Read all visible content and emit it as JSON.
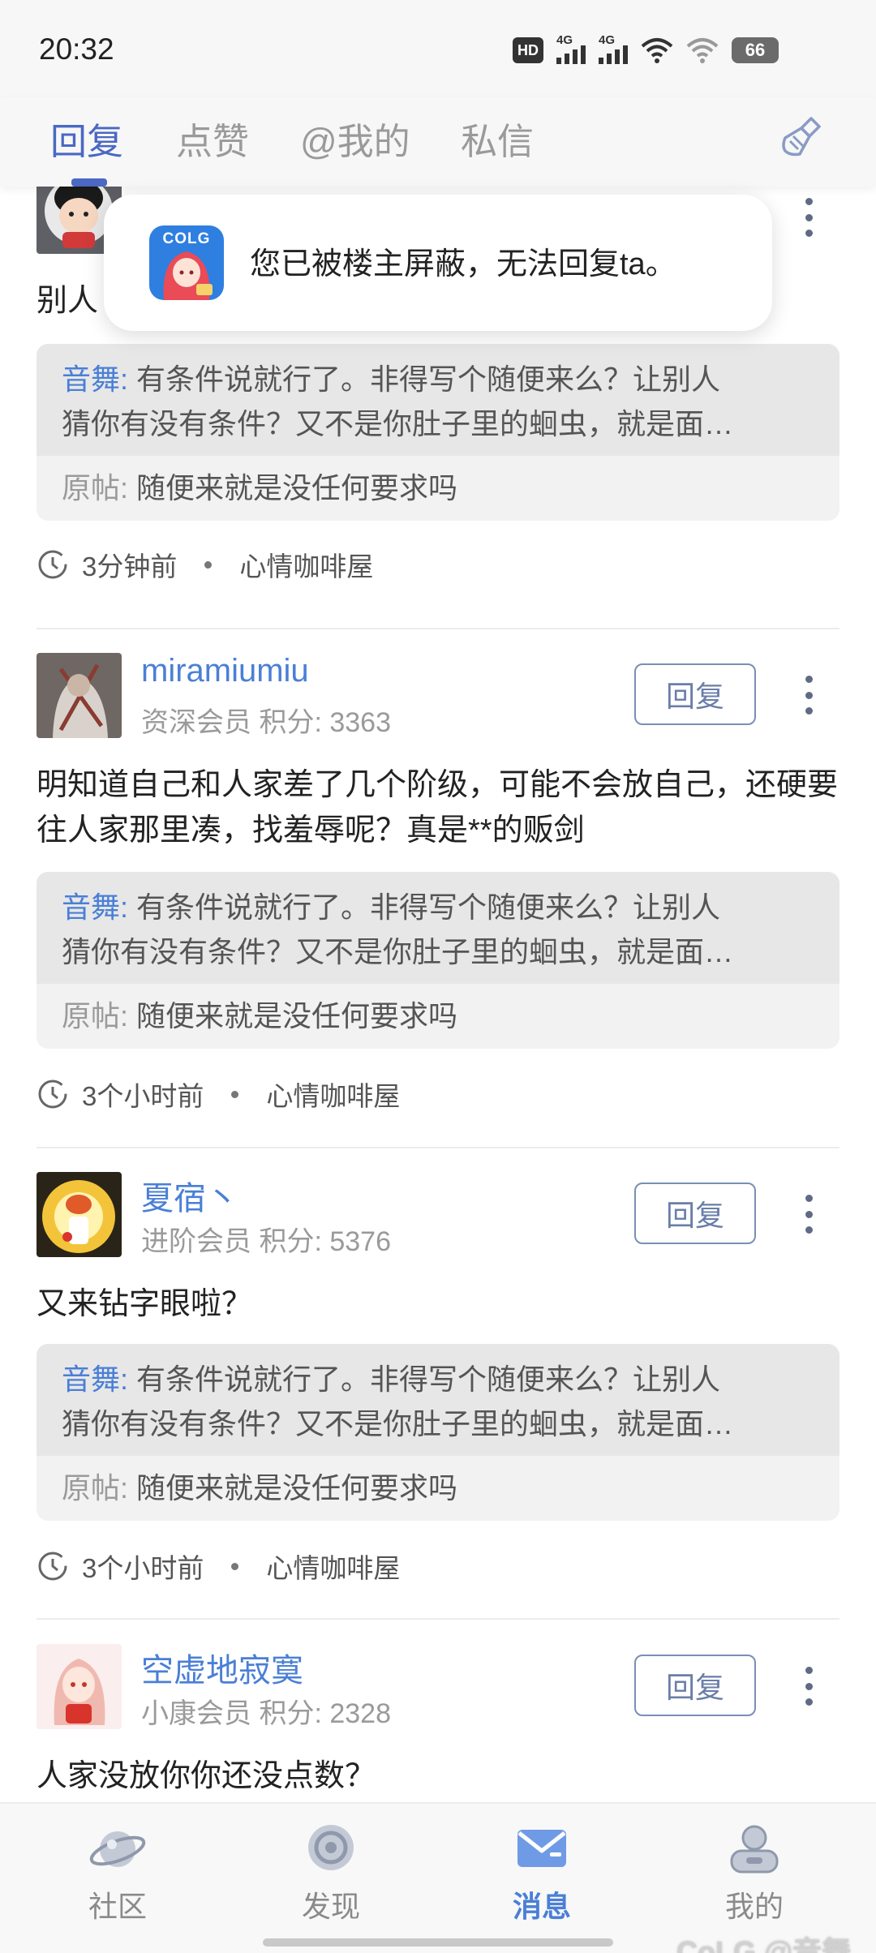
{
  "status_bar": {
    "time": "20:32",
    "hd_label": "HD",
    "net1": "4G",
    "net2": "4G",
    "battery": "66"
  },
  "tabs": [
    {
      "label": "回复",
      "active": true
    },
    {
      "label": "点赞",
      "active": false
    },
    {
      "label": "@我的",
      "active": false
    },
    {
      "label": "私信",
      "active": false
    }
  ],
  "toast": {
    "app_logo_text": "COLG",
    "message": "您已被楼主屏蔽，无法回复ta。"
  },
  "posts": [
    {
      "content": "别人",
      "quote": {
        "author": "音舞",
        "text_line1": "有条件说就行了。非得写个随便来么？让别人",
        "text_line2": "猜你有没有条件？又不是你肚子里的蛔虫，就是面…",
        "original_label": "原帖:",
        "original_text": "随便来就是没任何要求吗"
      },
      "time": "3分钟前",
      "board": "心情咖啡屋"
    },
    {
      "username": "miramiumiu",
      "level": "资深会员",
      "score": "积分: 3363",
      "reply_label": "回复",
      "content": "明知道自己和人家差了几个阶级，可能不会放自己，还硬要往人家那里凑，找羞辱呢？真是**的贩剑",
      "quote": {
        "author": "音舞",
        "text_line1": "有条件说就行了。非得写个随便来么？让别人",
        "text_line2": "猜你有没有条件？又不是你肚子里的蛔虫，就是面…",
        "original_label": "原帖:",
        "original_text": "随便来就是没任何要求吗"
      },
      "time": "3个小时前",
      "board": "心情咖啡屋"
    },
    {
      "username": "夏宿丶",
      "level": "进阶会员",
      "score": "积分: 5376",
      "reply_label": "回复",
      "content": "又来钻字眼啦？",
      "quote": {
        "author": "音舞",
        "text_line1": "有条件说就行了。非得写个随便来么？让别人",
        "text_line2": "猜你有没有条件？又不是你肚子里的蛔虫，就是面…",
        "original_label": "原帖:",
        "original_text": "随便来就是没任何要求吗"
      },
      "time": "3个小时前",
      "board": "心情咖啡屋"
    },
    {
      "username": "空虚地寂寞",
      "level": "小康会员",
      "score": "积分: 2328",
      "reply_label": "回复",
      "content": "人家没放你你还没点数？"
    }
  ],
  "bottom_nav": [
    {
      "label": "社区",
      "icon": "planet-icon",
      "active": false
    },
    {
      "label": "发现",
      "icon": "discover-icon",
      "active": false
    },
    {
      "label": "消息",
      "icon": "mail-icon",
      "active": true
    },
    {
      "label": "我的",
      "icon": "profile-icon",
      "active": false
    }
  ],
  "watermark": "CoLG @音舞",
  "colors": {
    "accent": "#4a68c4",
    "link": "#4a7fd6",
    "quote_bg": "#e7e7e7",
    "quote_bg_light": "#f2f2f2"
  }
}
